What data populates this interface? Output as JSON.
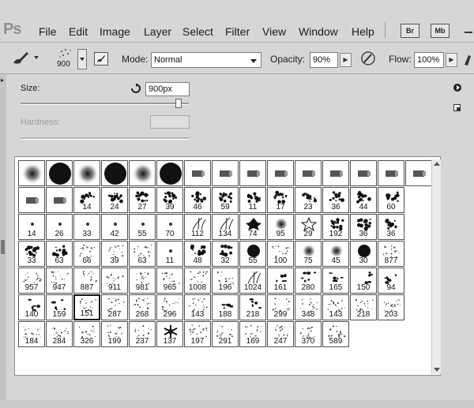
{
  "app": {
    "logo": "Ps"
  },
  "menu": {
    "items": [
      "File",
      "Edit",
      "Image",
      "Layer",
      "Select",
      "Filter",
      "View",
      "Window",
      "Help"
    ]
  },
  "menu_buttons": {
    "bridge": "Br",
    "minibridge": "Mb"
  },
  "options": {
    "brush_size": "900",
    "mode_label": "Mode:",
    "mode_value": "Normal",
    "opacity_label": "Opacity:",
    "opacity_value": "90%",
    "flow_label": "Flow:",
    "flow_value": "100%"
  },
  "brush_panel": {
    "size_label": "Size:",
    "size_value": "900px",
    "hardness_label": "Hardness:"
  },
  "icons": [
    "brush-tool-icon",
    "dropdown-arrow-icon",
    "brush-preset-icon",
    "toggle-brush-panel-icon",
    "opacity-pressure-icon",
    "reset-size-icon",
    "panel-menu-icon",
    "new-preset-icon",
    "dock-handle-icon"
  ],
  "brush_rows": [
    [
      {
        "type": "soft",
        "n": ""
      },
      {
        "type": "hard",
        "n": ""
      },
      {
        "type": "soft",
        "n": ""
      },
      {
        "type": "hard",
        "n": ""
      },
      {
        "type": "soft",
        "n": ""
      },
      {
        "type": "hard",
        "n": ""
      },
      {
        "type": "chalk",
        "n": ""
      },
      {
        "type": "chalk",
        "n": ""
      },
      {
        "type": "chalk",
        "n": ""
      },
      {
        "type": "chalk",
        "n": ""
      },
      {
        "type": "chalk",
        "n": ""
      },
      {
        "type": "chalk",
        "n": ""
      },
      {
        "type": "chalk",
        "n": ""
      },
      {
        "type": "chalk",
        "n": ""
      },
      {
        "type": "chalk",
        "n": ""
      }
    ],
    [
      {
        "type": "chalk",
        "n": ""
      },
      {
        "type": "chalk",
        "n": ""
      },
      {
        "type": "splat",
        "n": "14"
      },
      {
        "type": "splat",
        "n": "24"
      },
      {
        "type": "splat",
        "n": "27"
      },
      {
        "type": "splat",
        "n": "39"
      },
      {
        "type": "splat",
        "n": "46"
      },
      {
        "type": "splat",
        "n": "59"
      },
      {
        "type": "splat",
        "n": "11"
      },
      {
        "type": "splat",
        "n": "17"
      },
      {
        "type": "splat",
        "n": "23"
      },
      {
        "type": "splat",
        "n": "36"
      },
      {
        "type": "splat",
        "n": "44"
      },
      {
        "type": "splat",
        "n": "60"
      }
    ],
    [
      {
        "type": "tiny",
        "n": "14"
      },
      {
        "type": "tiny",
        "n": "26"
      },
      {
        "type": "tiny",
        "n": "33"
      },
      {
        "type": "tiny",
        "n": "42"
      },
      {
        "type": "tiny",
        "n": "55"
      },
      {
        "type": "tiny",
        "n": "70"
      },
      {
        "type": "grass",
        "n": "112"
      },
      {
        "type": "grass",
        "n": "134"
      },
      {
        "type": "leaf",
        "n": "74"
      },
      {
        "type": "soft",
        "n": "95"
      },
      {
        "type": "star",
        "n": "29"
      },
      {
        "type": "splat",
        "n": "192"
      },
      {
        "type": "splat",
        "n": "36"
      },
      {
        "type": "splat",
        "n": "36"
      }
    ],
    [
      {
        "type": "splat",
        "n": "33"
      },
      {
        "type": "splat",
        "n": "63"
      },
      {
        "type": "speckle",
        "n": "66"
      },
      {
        "type": "speckle",
        "n": "39"
      },
      {
        "type": "speckle",
        "n": "63"
      },
      {
        "type": "tiny",
        "n": "11"
      },
      {
        "type": "splat",
        "n": "48"
      },
      {
        "type": "splat",
        "n": "32"
      },
      {
        "type": "hard",
        "n": "55"
      },
      {
        "type": "speckle",
        "n": "100"
      },
      {
        "type": "soft",
        "n": "75"
      },
      {
        "type": "soft",
        "n": "45"
      },
      {
        "type": "hard",
        "n": "30"
      },
      {
        "type": "speckle",
        "n": "877"
      }
    ],
    [
      {
        "type": "speckle",
        "n": "957"
      },
      {
        "type": "speckle",
        "n": "947"
      },
      {
        "type": "speckle",
        "n": "887"
      },
      {
        "type": "speckle",
        "n": "911"
      },
      {
        "type": "speckle",
        "n": "981"
      },
      {
        "type": "speckle",
        "n": "965"
      },
      {
        "type": "speckle",
        "n": "1008"
      },
      {
        "type": "speckle",
        "n": "196"
      },
      {
        "type": "grass",
        "n": "1024"
      },
      {
        "type": "dots",
        "n": "161"
      },
      {
        "type": "dots",
        "n": "280"
      },
      {
        "type": "dots",
        "n": "165"
      },
      {
        "type": "dots",
        "n": "150"
      },
      {
        "type": "dots",
        "n": "94"
      }
    ],
    [
      {
        "type": "dots",
        "n": "140"
      },
      {
        "type": "dots",
        "n": "159"
      },
      {
        "type": "speckle",
        "n": "151"
      },
      {
        "type": "speckle",
        "n": "287"
      },
      {
        "type": "speckle",
        "n": "268"
      },
      {
        "type": "speckle",
        "n": "296"
      },
      {
        "type": "speckle",
        "n": "143"
      },
      {
        "type": "dots",
        "n": "188"
      },
      {
        "type": "dots",
        "n": "218"
      },
      {
        "type": "speckle",
        "n": "299"
      },
      {
        "type": "speckle",
        "n": "348"
      },
      {
        "type": "speckle",
        "n": "143"
      },
      {
        "type": "speckle",
        "n": "218"
      },
      {
        "type": "speckle",
        "n": "203"
      }
    ],
    [
      {
        "type": "speckle",
        "n": "184"
      },
      {
        "type": "speckle",
        "n": "284"
      },
      {
        "type": "speckle",
        "n": "326"
      },
      {
        "type": "speckle",
        "n": "199"
      },
      {
        "type": "speckle",
        "n": "237"
      },
      {
        "type": "flake",
        "n": "137"
      },
      {
        "type": "speckle",
        "n": "197"
      },
      {
        "type": "speckle",
        "n": "291"
      },
      {
        "type": "speckle",
        "n": "169"
      },
      {
        "type": "speckle",
        "n": "247"
      },
      {
        "type": "speckle",
        "n": "370"
      },
      {
        "type": "speckle",
        "n": "589"
      }
    ]
  ],
  "selected_brush": {
    "row": 5,
    "col": 2
  }
}
